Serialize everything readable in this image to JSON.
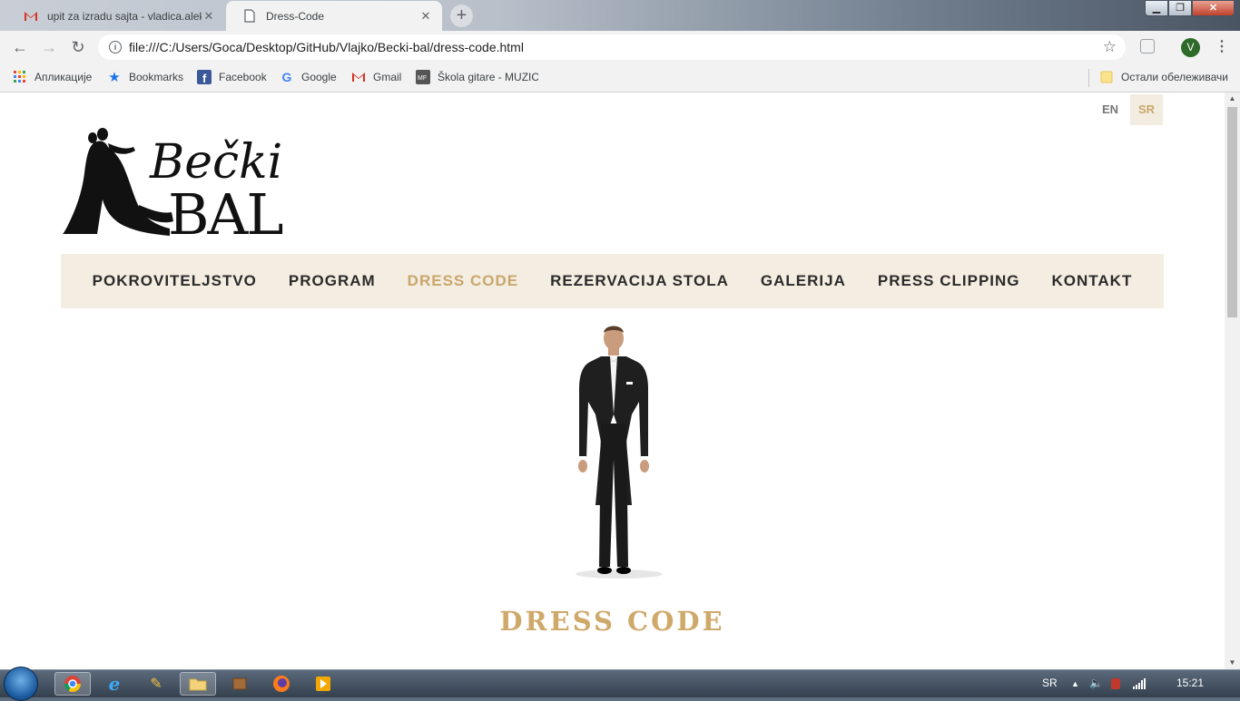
{
  "browser": {
    "tabs": [
      {
        "title": "upit za izradu sajta - vladica.aleks",
        "icon": "gmail-icon",
        "active": false
      },
      {
        "title": "Dress-Code",
        "icon": "page-icon",
        "active": true
      }
    ],
    "url": "file:///C:/Users/Goca/Desktop/GitHub/Vlajko/Becki-bal/dress-code.html",
    "profile_initial": "V",
    "bookmarks": [
      {
        "label": "Апликације",
        "icon": "apps-icon"
      },
      {
        "label": "Bookmarks",
        "icon": "star-icon"
      },
      {
        "label": "Facebook",
        "icon": "facebook-icon"
      },
      {
        "label": "Google",
        "icon": "google-icon"
      },
      {
        "label": "Gmail",
        "icon": "gmail-icon"
      },
      {
        "label": "Škola gitare - MUZIC",
        "icon": "mf-icon"
      }
    ],
    "other_bookmarks": "Остали обележивачи"
  },
  "page": {
    "lang": {
      "en": "EN",
      "sr": "SR",
      "active": "SR"
    },
    "logo_text": {
      "line1": "Bečki",
      "line2": "BAL"
    },
    "nav": [
      {
        "label": "POKROVITELJSTVO",
        "active": false
      },
      {
        "label": "PROGRAM",
        "active": false
      },
      {
        "label": "DRESS CODE",
        "active": true
      },
      {
        "label": "REZERVACIJA STOLA",
        "active": false
      },
      {
        "label": "GALERIJA",
        "active": false
      },
      {
        "label": "PRESS CLIPPING",
        "active": false
      },
      {
        "label": "KONTAKT",
        "active": false
      }
    ],
    "heading": "DRESS CODE"
  },
  "taskbar": {
    "lang": "SR",
    "clock": "15:21"
  },
  "colors": {
    "accent": "#c9a76b",
    "nav_bg": "#f4ede2",
    "heading": "#cfa96a"
  }
}
